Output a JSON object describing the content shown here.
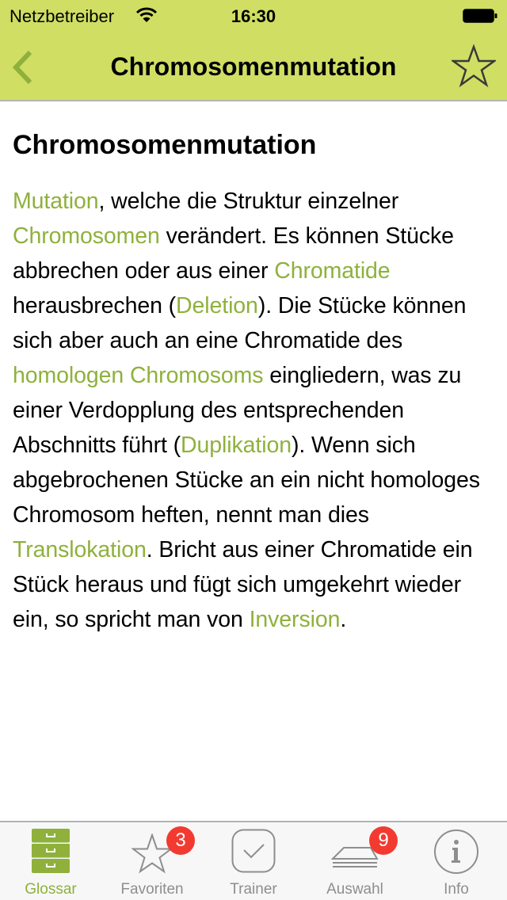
{
  "status_bar": {
    "carrier": "Netzbetreiber",
    "time": "16:30",
    "wifi_icon": "wifi-icon",
    "battery_icon": "battery-icon"
  },
  "nav": {
    "title": "Chromosomenmutation",
    "back_icon": "chevron-left-icon",
    "favorite_icon": "star-outline-icon"
  },
  "article": {
    "title": "Chromosomenmutation",
    "segments": [
      {
        "text": "Mutation",
        "link": true
      },
      {
        "text": ", welche die Struktur einzelner ",
        "link": false
      },
      {
        "text": "Chromosomen",
        "link": true
      },
      {
        "text": " verändert. Es können Stücke abbrechen oder aus einer ",
        "link": false
      },
      {
        "text": "Chromatide",
        "link": true
      },
      {
        "text": " herausbrechen (",
        "link": false
      },
      {
        "text": "Deletion",
        "link": true
      },
      {
        "text": "). Die Stücke können sich aber auch an eine Chromatide des ",
        "link": false
      },
      {
        "text": "homologen Chromosoms",
        "link": true
      },
      {
        "text": " eingliedern, was zu einer Verdopplung des entsprechenden Abschnitts führt (",
        "link": false
      },
      {
        "text": "Duplikation",
        "link": true
      },
      {
        "text": "). Wenn sich abgebrochenen Stücke an ein nicht homologes Chromosom heften, nennt man dies ",
        "link": false
      },
      {
        "text": "Translokation",
        "link": true
      },
      {
        "text": ". Bricht aus einer Chromatide ein Stück heraus und fügt sich umgekehrt wieder ein, so spricht man von ",
        "link": false
      },
      {
        "text": "Inversion",
        "link": true
      },
      {
        "text": ".",
        "link": false
      }
    ]
  },
  "tabbar": {
    "tabs": [
      {
        "label": "Glossar",
        "icon": "file-cabinet-icon",
        "active": true,
        "badge": null
      },
      {
        "label": "Favoriten",
        "icon": "star-icon",
        "active": false,
        "badge": "3"
      },
      {
        "label": "Trainer",
        "icon": "checkbox-icon",
        "active": false,
        "badge": null
      },
      {
        "label": "Auswahl",
        "icon": "card-stack-icon",
        "active": false,
        "badge": "9"
      },
      {
        "label": "Info",
        "icon": "info-icon",
        "active": false,
        "badge": null
      }
    ]
  },
  "colors": {
    "header_bg": "#d0de64",
    "accent": "#8fb13c",
    "badge": "#f23a30",
    "inactive": "#8e8e8e"
  }
}
